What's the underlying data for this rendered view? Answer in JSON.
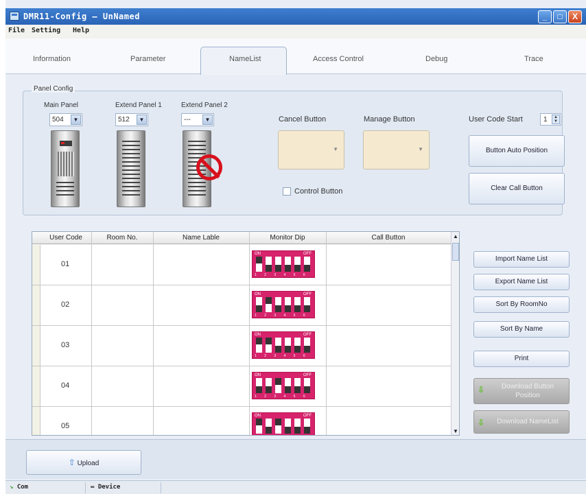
{
  "window": {
    "title": "DMR11-Config — UnNamed",
    "min": "_",
    "max": "□",
    "close": "X"
  },
  "menu": {
    "file": "File",
    "setting": "Setting",
    "help": "Help"
  },
  "tabs": [
    "Information",
    "Parameter",
    "NameList",
    "Access Control",
    "Debug",
    "Trace"
  ],
  "active_tab": "NameList",
  "panel_config": {
    "legend": "Panel Config",
    "main_panel": {
      "label": "Main Panel",
      "value": "504"
    },
    "extend1": {
      "label": "Extend Panel 1",
      "value": "512"
    },
    "extend2": {
      "label": "Extend Panel 2",
      "value": "---"
    },
    "cancel_button": "Cancel Button",
    "manage_button": "Manage Button",
    "control_button": "Control Button",
    "user_code_start": {
      "label": "User Code Start",
      "value": "1"
    },
    "auto_position": "Button Auto Position",
    "clear_call": "Clear Call Button"
  },
  "table": {
    "headers": [
      "User Code",
      "Room No.",
      "Name Lable",
      "Monitor Dip",
      "Call Button"
    ],
    "rows": [
      {
        "code": "01"
      },
      {
        "code": "02"
      },
      {
        "code": "03"
      },
      {
        "code": "04"
      },
      {
        "code": "05"
      }
    ],
    "dip_on": "ON",
    "dip_off": "OFF",
    "dip_numbers": "1 2 3 4 5 6"
  },
  "actions": {
    "import": "Import Name List",
    "export": "Export Name List",
    "sort_room": "Sort By RoomNo",
    "sort_name": "Sort By Name",
    "print": "Print",
    "download_pos": "Download Button Position",
    "download_name": "Download NameList"
  },
  "upload": "Upload",
  "status": {
    "com": "Com",
    "device": "Device"
  },
  "colors": {
    "titlebar": "#2a63b5",
    "dip": "#d6236c",
    "close": "#c9421b"
  }
}
